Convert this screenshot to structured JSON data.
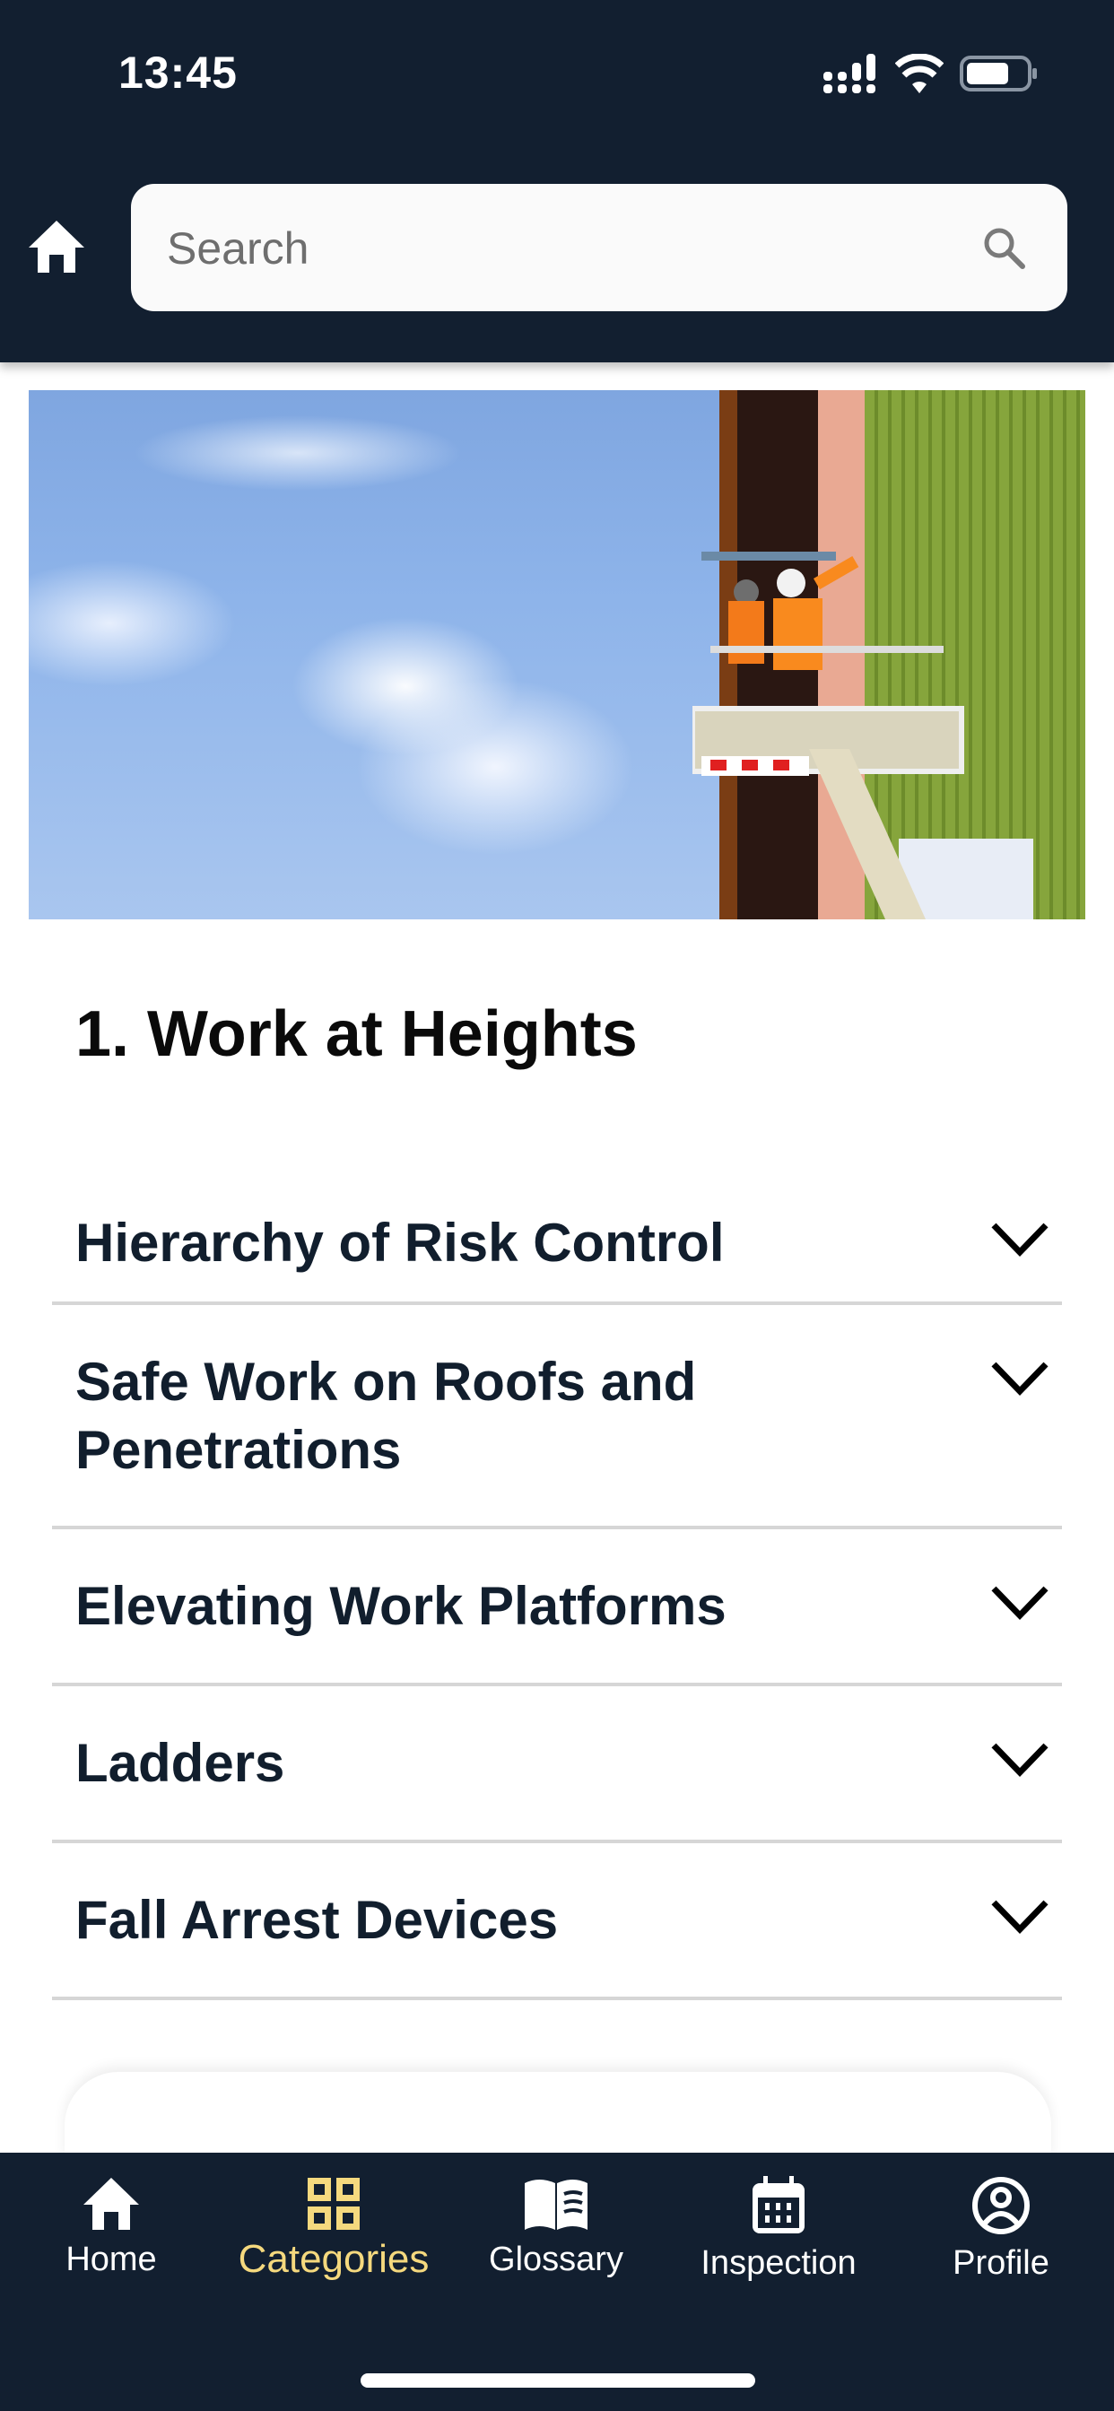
{
  "status_bar": {
    "time": "13:45",
    "icons": [
      "cellular-signal-icon",
      "wifi-icon",
      "battery-icon"
    ]
  },
  "header": {
    "home_icon": "home-icon",
    "search": {
      "placeholder": "Search",
      "value": "",
      "icon": "search-icon"
    }
  },
  "hero_image": {
    "alt": "Two workers in orange hi-vis on an elevating work platform beside a green building under a cloudy blue sky"
  },
  "section": {
    "title": "1. Work at Heights"
  },
  "accordion": {
    "items": [
      {
        "label": "Hierarchy of Risk Control",
        "icon": "chevron-down-icon"
      },
      {
        "label": "Safe Work on Roofs and Penetrations",
        "icon": "chevron-down-icon"
      },
      {
        "label": "Elevating Work Platforms",
        "icon": "chevron-down-icon"
      },
      {
        "label": "Ladders",
        "icon": "chevron-down-icon"
      },
      {
        "label": "Fall Arrest Devices",
        "icon": "chevron-down-icon"
      }
    ]
  },
  "tab_bar": {
    "active": "Categories",
    "tabs": [
      {
        "label": "Home",
        "icon": "home-icon"
      },
      {
        "label": "Categories",
        "icon": "grid-icon"
      },
      {
        "label": "Glossary",
        "icon": "book-icon"
      },
      {
        "label": "Inspection",
        "icon": "calendar-icon"
      },
      {
        "label": "Profile",
        "icon": "profile-icon"
      }
    ]
  },
  "colors": {
    "header_bg": "#121f30",
    "active_tab": "#f5d97e",
    "text_dark": "#111e2d",
    "divider": "#d6d6d6"
  }
}
